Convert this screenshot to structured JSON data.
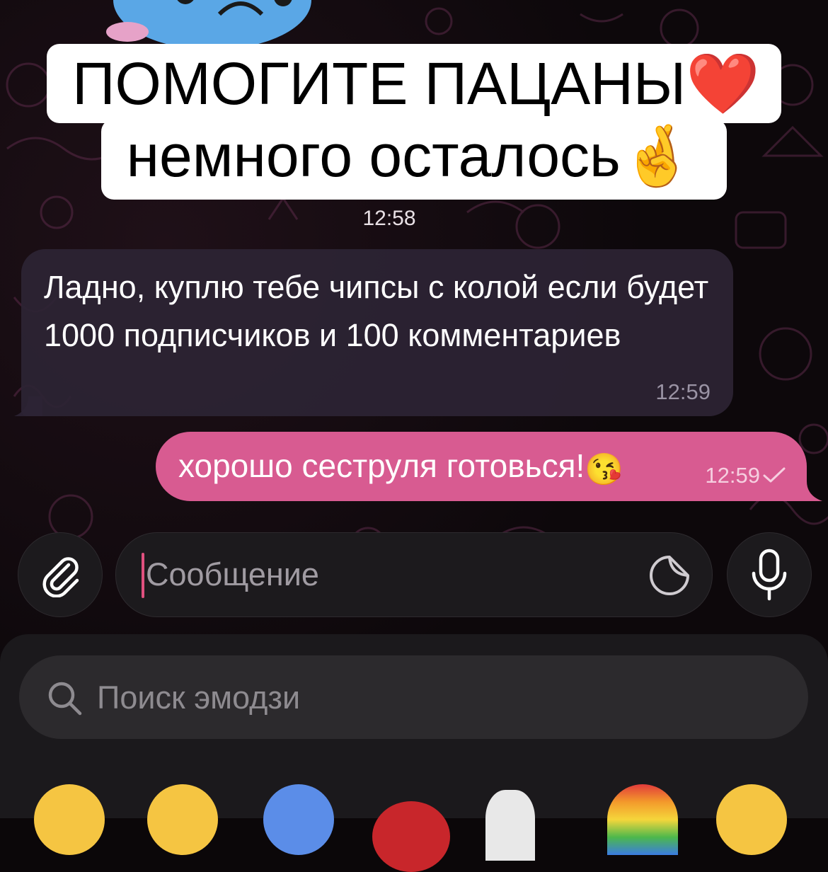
{
  "overlay": {
    "line1": "ПОМОГИТЕ ПАЦАНЫ❤️",
    "line2": "немного осталось🤞"
  },
  "chat": {
    "date_time": "12:58",
    "messages": [
      {
        "direction": "incoming",
        "text": "Ладно, куплю тебе чипсы с колой если будет 1000 подписчиков и 100 комментариев",
        "time": "12:59"
      },
      {
        "direction": "outgoing",
        "text": "хорошо сеструля готовься!",
        "emoji": "😘",
        "time": "12:59",
        "status": "sent"
      }
    ]
  },
  "composer": {
    "placeholder": "Сообщение",
    "attach_icon": "paperclip-icon",
    "sticker_icon": "sticker-icon",
    "mic_icon": "microphone-icon"
  },
  "emoji_panel": {
    "search_placeholder": "Поиск эмодзи",
    "emoji_row": [
      "🤧",
      "😏",
      "🥶",
      "🎅",
      "👻",
      "🌈",
      "🥰"
    ]
  },
  "colors": {
    "accent": "#d85b91",
    "incoming_bubble": "#2c2434",
    "caret": "#e0507f",
    "background": "#0b0709"
  }
}
